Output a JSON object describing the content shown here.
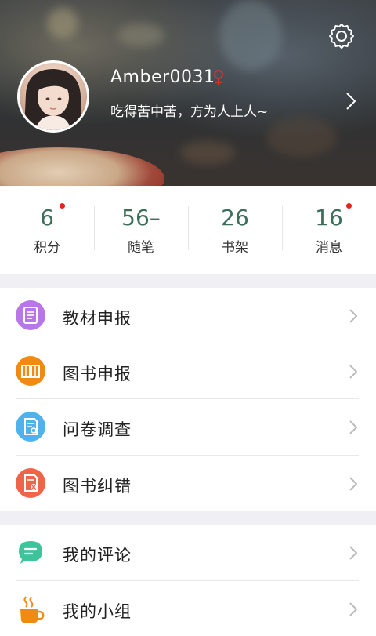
{
  "profile": {
    "username": "Amber0031",
    "bio": "吃得苦中苦，方为人上人~"
  },
  "stats": [
    {
      "value": "6",
      "label": "积分",
      "badge": true
    },
    {
      "value": "56–",
      "label": "随笔",
      "badge": false
    },
    {
      "value": "26",
      "label": "书架",
      "badge": false
    },
    {
      "value": "16",
      "label": "消息",
      "badge": true
    }
  ],
  "menu": {
    "section1": [
      {
        "label": "教材申报",
        "icon": "textbook-icon",
        "color": "#b777e8"
      },
      {
        "label": "图书申报",
        "icon": "open-book-icon",
        "color": "#f08a12"
      },
      {
        "label": "问卷调查",
        "icon": "survey-icon",
        "color": "#4fb2ec"
      },
      {
        "label": "图书纠错",
        "icon": "error-report-icon",
        "color": "#f0644a"
      }
    ],
    "section2": [
      {
        "label": "我的评论",
        "icon": "comment-icon",
        "color": "#3ec49a"
      },
      {
        "label": "我的小组",
        "icon": "coffee-cup-icon",
        "color": "#f08a12"
      }
    ]
  },
  "colors": {
    "stat_number": "#3c6e5a",
    "badge": "#e5241c",
    "section_gap": "#efeff4"
  }
}
